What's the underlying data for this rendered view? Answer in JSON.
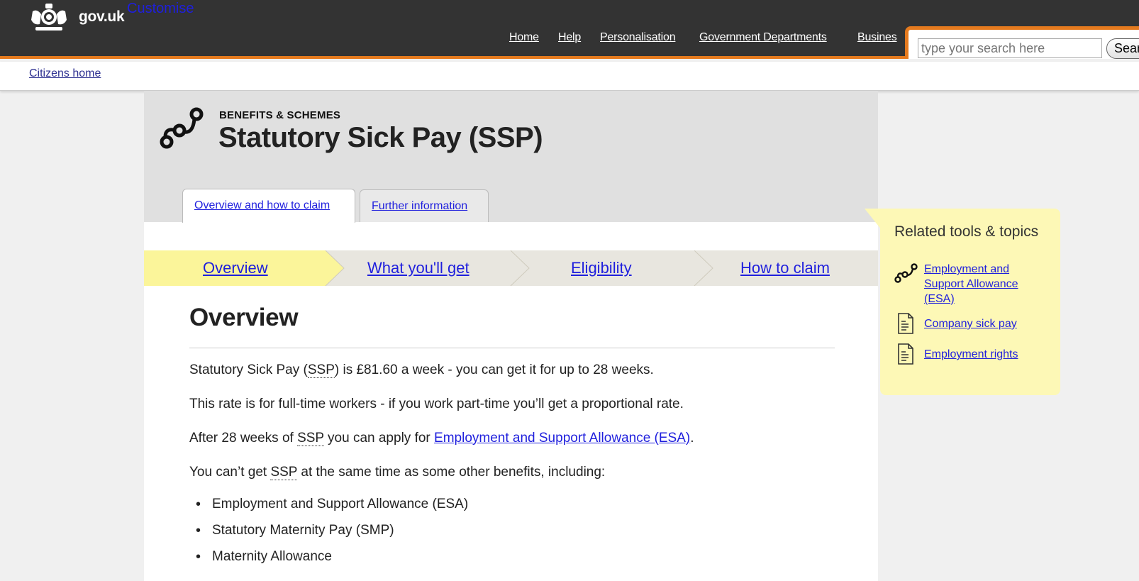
{
  "header": {
    "brand": "gov.uk",
    "customise": "Customise",
    "nav": [
      "Home",
      "Help",
      "Personalisation",
      "Government Departments",
      "Busines"
    ],
    "search_placeholder": "type your search here",
    "search_button": "Sear"
  },
  "breadcrumb": {
    "label": "Citizens home"
  },
  "page": {
    "kicker": "BENEFITS & SCHEMES",
    "title": "Statutory Sick Pay (SSP)",
    "tabs": [
      "Overview and how to claim",
      "Further information"
    ],
    "steps": [
      "Overview",
      "What you'll get",
      "Eligibility",
      "How to claim"
    ]
  },
  "content": {
    "heading": "Overview",
    "p1_a": "Statutory Sick Pay (",
    "p1_abbr": "SSP",
    "p1_b": ") is £81.60 a week - you can get it for up to 28 weeks.",
    "p2": "This rate is for full-time workers - if you work part-time you’ll get a proportional rate.",
    "p3_a": "After 28 weeks of ",
    "p3_abbr": "SSP",
    "p3_b": " you can apply for ",
    "p3_link": "Employment and Support Allowance (ESA)",
    "p3_c": ".",
    "p4_a": "You can’t get ",
    "p4_abbr": "SSP",
    "p4_b": " at the same time as some other benefits, including:",
    "bullets": [
      "Employment and Support Allowance (ESA)",
      "Statutory Maternity Pay (SMP)",
      "Maternity Allowance"
    ]
  },
  "sidebar": {
    "title": "Related tools & topics",
    "items": [
      {
        "label": "Employment and Support Allowance (ESA)",
        "icon": "chain-link-icon"
      },
      {
        "label": "Company sick pay",
        "icon": "document-icon"
      },
      {
        "label": "Employment rights",
        "icon": "document-icon"
      }
    ]
  },
  "colors": {
    "header_bg": "#333333",
    "accent_orange": "#e57a1e",
    "link": "#1f1fdd",
    "step_active": "#fbf59a",
    "sidebar_bg": "#fdf8b6"
  }
}
